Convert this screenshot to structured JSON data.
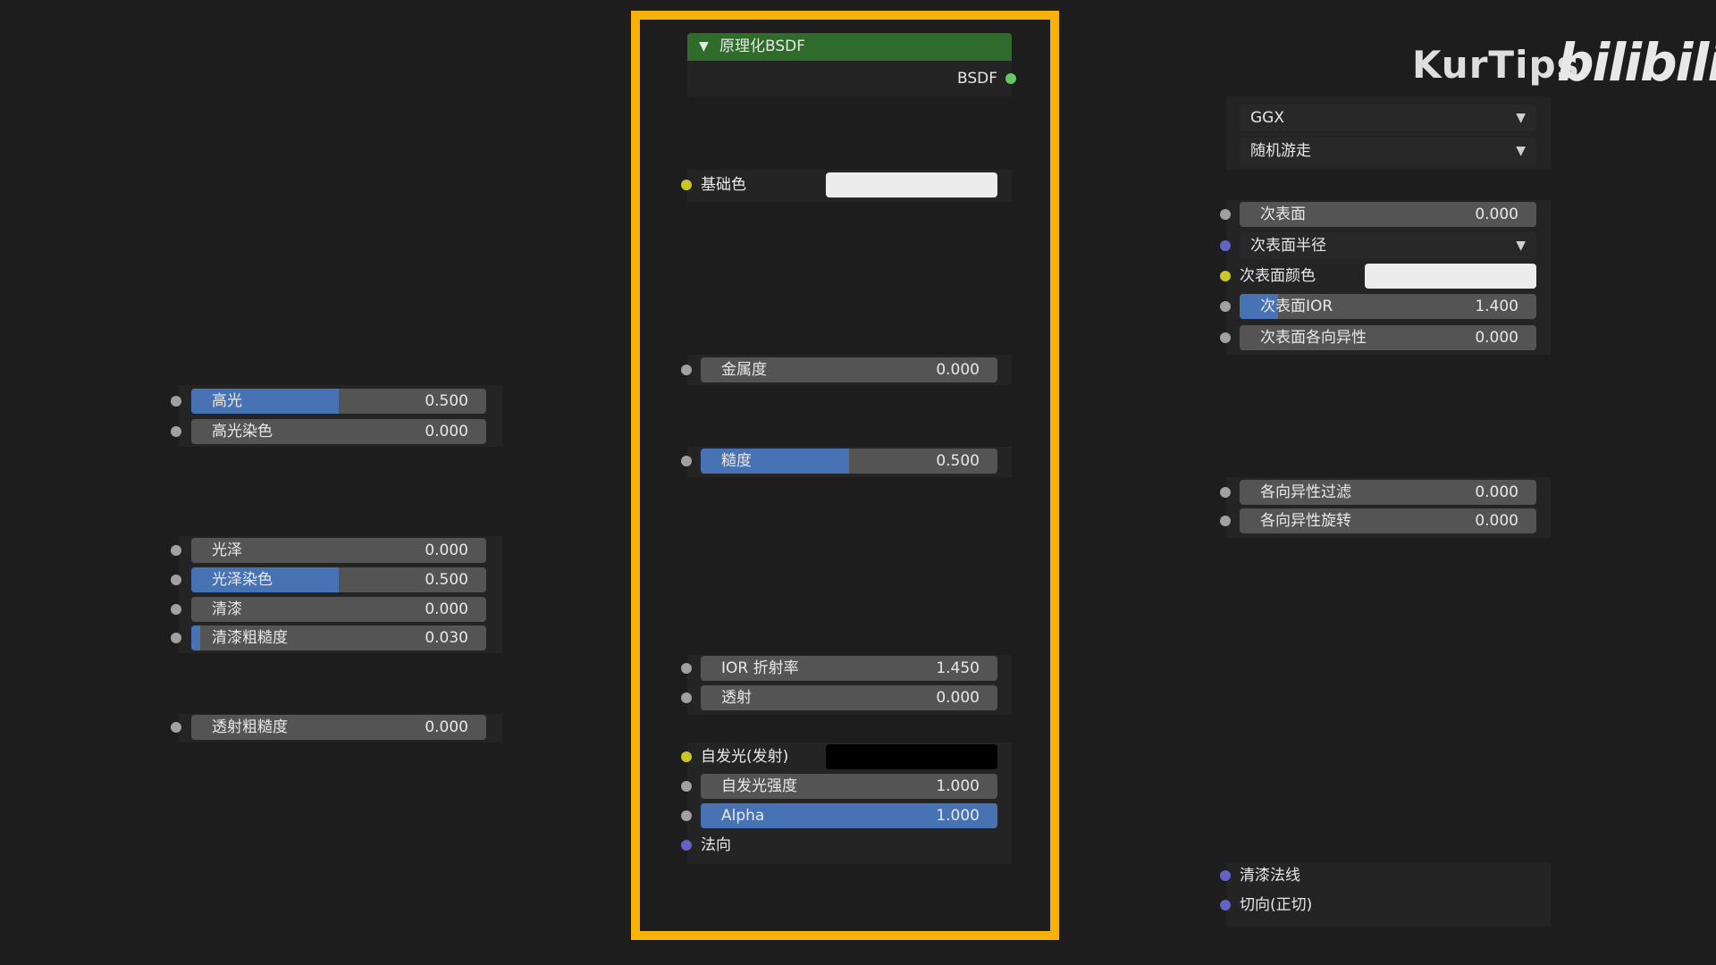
{
  "watermark": {
    "channel": "KurTips",
    "platform": "bilibili"
  },
  "center_node": {
    "title": "原理化BSDF",
    "output_label": "BSDF",
    "base_color_label": "基础色",
    "base_color": "#ececec",
    "metallic": {
      "label": "金属度",
      "value": "0.000",
      "fraction": 0.0
    },
    "roughness": {
      "label": "糙度",
      "value": "0.500",
      "fraction": 0.5
    },
    "ior": {
      "label": "IOR 折射率",
      "value": "1.450",
      "fraction": 0.0
    },
    "transmission": {
      "label": "透射",
      "value": "0.000",
      "fraction": 0.0
    },
    "emission_label": "自发光(发射)",
    "emission_color": "#000000",
    "emission_strength": {
      "label": "自发光强度",
      "value": "1.000",
      "fraction": 0.0
    },
    "alpha": {
      "label": "Alpha",
      "value": "1.000",
      "fraction": 1.0
    },
    "normal_label": "法向"
  },
  "left_panel": {
    "specular": {
      "label": "高光",
      "value": "0.500",
      "fraction": 0.5
    },
    "specular_tint": {
      "label": "高光染色",
      "value": "0.000",
      "fraction": 0.0
    },
    "sheen": {
      "label": "光泽",
      "value": "0.000",
      "fraction": 0.0
    },
    "sheen_tint": {
      "label": "光泽染色",
      "value": "0.500",
      "fraction": 0.5
    },
    "clearcoat": {
      "label": "清漆",
      "value": "0.000",
      "fraction": 0.0
    },
    "clearcoat_roughness": {
      "label": "清漆粗糙度",
      "value": "0.030",
      "fraction": 0.03
    },
    "transmission_roughness": {
      "label": "透射粗糙度",
      "value": "0.000",
      "fraction": 0.0
    }
  },
  "right_panel": {
    "distribution": "GGX",
    "subsurface_method": "随机游走",
    "subsurface": {
      "label": "次表面",
      "value": "0.000",
      "fraction": 0.0
    },
    "subsurface_radius_label": "次表面半径",
    "subsurface_color_label": "次表面颜色",
    "subsurface_color": "#ececec",
    "subsurface_ior": {
      "label": "次表面IOR",
      "value": "1.400",
      "fraction": 0.13
    },
    "subsurface_anisotropy": {
      "label": "次表面各向异性",
      "value": "0.000",
      "fraction": 0.0
    },
    "anisotropic": {
      "label": "各向异性过滤",
      "value": "0.000",
      "fraction": 0.0
    },
    "anisotropic_rotation": {
      "label": "各向异性旋转",
      "value": "0.000",
      "fraction": 0.0
    },
    "clearcoat_normal_label": "清漆法线",
    "tangent_label": "切向(正切)"
  },
  "colors": {
    "highlight_frame": "#f7b20a",
    "node_header": "#2f6b2a",
    "slider_fill": "#4772b3",
    "socket_float": "#a1a1a1",
    "socket_color": "#c7c729",
    "socket_vector": "#6363c7",
    "socket_shader": "#63c763"
  },
  "icons": {
    "collapse": "chevron-down-icon",
    "dropdown": "chevron-down-icon"
  }
}
